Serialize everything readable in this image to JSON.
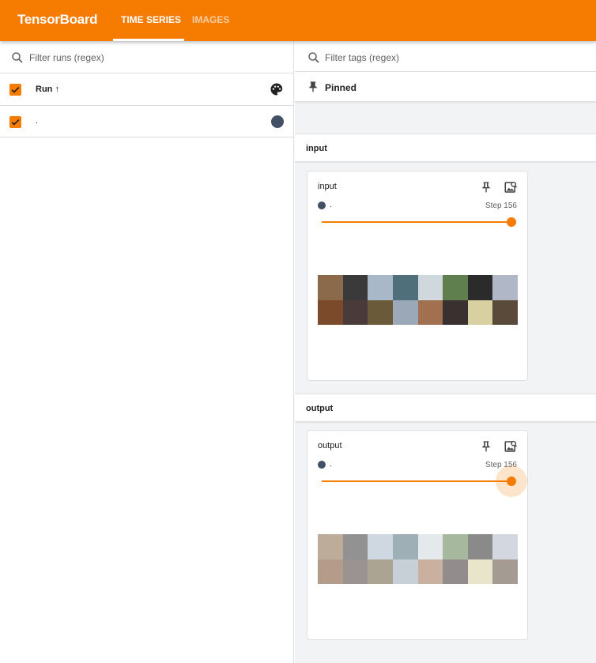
{
  "app": {
    "brand": "TensorBoard",
    "accent": "#f57c00",
    "tabs": [
      {
        "label": "TIME SERIES",
        "active": true
      },
      {
        "label": "IMAGES",
        "active": false
      }
    ]
  },
  "sidebar": {
    "filter_placeholder": "Filter runs (regex)",
    "column_label": "Run ↑",
    "runs": [
      {
        "name": ".",
        "checked": true,
        "color": "#425066"
      }
    ]
  },
  "main": {
    "tag_filter_placeholder": "Filter tags (regex)",
    "pinned_label": "Pinned",
    "groups": [
      {
        "name": "input",
        "card": {
          "title": "input",
          "run_name": ".",
          "step_label": "Step 156",
          "grid_colors": [
            "#8a6a4a",
            "#3a3a3a",
            "#a9b8c8",
            "#4f6f7a",
            "#cfd8dc",
            "#5f7f4f",
            "#2b2b2b",
            "#b0b8c8",
            "#7a4a2a",
            "#4a3a3a",
            "#6a5a3a",
            "#9aa8b8",
            "#a07050",
            "#3a3030",
            "#d8d0a0",
            "#5a4a3a"
          ],
          "faded": false
        }
      },
      {
        "name": "output",
        "card": {
          "title": "output",
          "run_name": ".",
          "step_label": "Step 156",
          "grid_colors": [
            "#8a6a4a",
            "#3a3a3a",
            "#a9b8c8",
            "#4f6f7a",
            "#cfd8dc",
            "#5f7f4f",
            "#2b2b2b",
            "#b0b8c8",
            "#7a4a2a",
            "#4a3a3a",
            "#6a5a3a",
            "#9aa8b8",
            "#a07050",
            "#3a3030",
            "#d8d0a0",
            "#5a4a3a"
          ],
          "faded": true
        }
      }
    ]
  }
}
